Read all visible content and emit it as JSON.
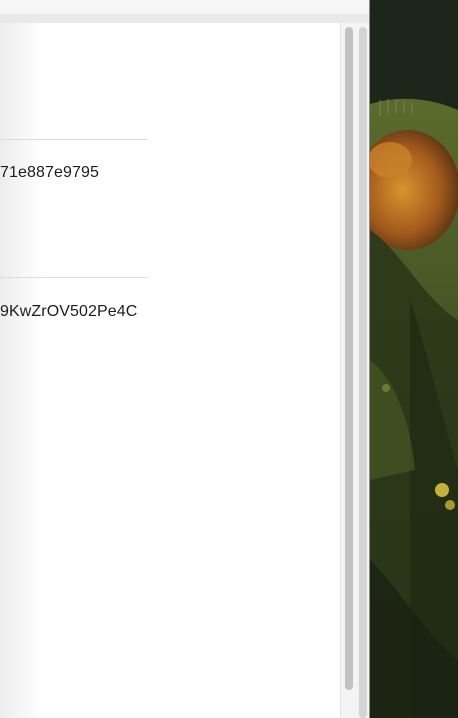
{
  "window": {
    "fields": [
      {
        "value": "71e887e9795"
      },
      {
        "value": "9KwZrOV502Pe4C"
      }
    ]
  },
  "desktop": {
    "wallpaper": "landscape-wallpaper"
  },
  "colors": {
    "window_background": "#ffffff",
    "divider": "#dcdcdc",
    "text": "#1d1d1f",
    "scrollbar_thumb": "#c2c2c2"
  }
}
